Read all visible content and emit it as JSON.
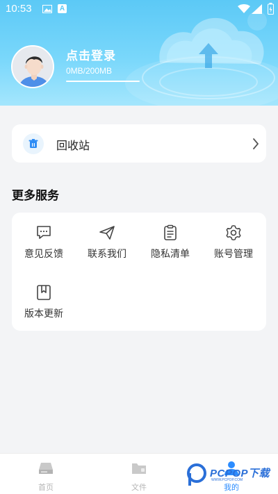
{
  "status_bar": {
    "time": "10:53",
    "a_icon_letter": "A"
  },
  "profile": {
    "login_label": "点击登录",
    "storage_text": "0MB/200MB"
  },
  "recycle_bin": {
    "label": "回收站"
  },
  "services": {
    "title": "更多服务",
    "items": [
      {
        "label": "意见反馈",
        "icon": "feedback-icon"
      },
      {
        "label": "联系我们",
        "icon": "send-icon"
      },
      {
        "label": "隐私清单",
        "icon": "clipboard-icon"
      },
      {
        "label": "账号管理",
        "icon": "gear-icon"
      },
      {
        "label": "版本更新",
        "icon": "bookmark-icon"
      }
    ]
  },
  "bottom_nav": {
    "items": [
      {
        "label": "首页",
        "icon": "home-drive-icon",
        "active": false
      },
      {
        "label": "文件",
        "icon": "folder-icon",
        "active": false
      },
      {
        "label": "我的",
        "icon": "user-icon",
        "active": true
      }
    ]
  },
  "watermark": {
    "text": "PCPOP下载",
    "sub": "WWW.PCPOP.COM"
  },
  "colors": {
    "header_top": "#5cc9f6",
    "header_bottom": "#a4e6fd",
    "accent": "#2b8cff",
    "background": "#f3f4f6"
  }
}
